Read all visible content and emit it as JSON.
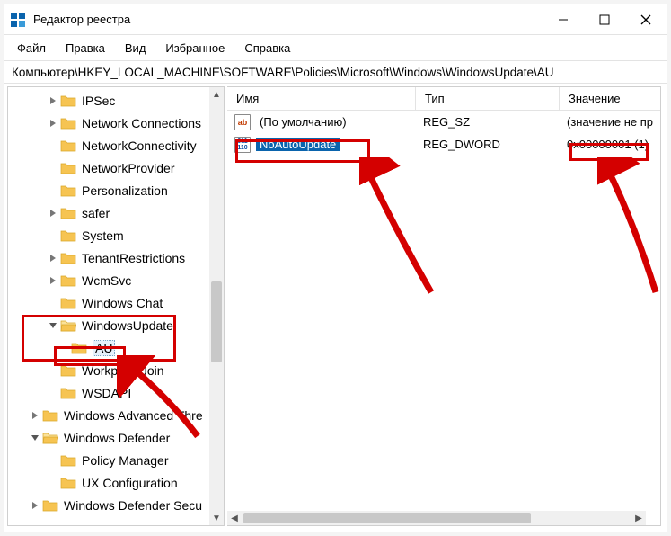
{
  "title": "Редактор реестра",
  "menu": [
    "Файл",
    "Правка",
    "Вид",
    "Избранное",
    "Справка"
  ],
  "address": "Компьютер\\HKEY_LOCAL_MACHINE\\SOFTWARE\\Policies\\Microsoft\\Windows\\WindowsUpdate\\AU",
  "tree": [
    {
      "label": "IPSec",
      "depth": 1,
      "exp": "r"
    },
    {
      "label": "Network Connections",
      "depth": 1,
      "exp": "r"
    },
    {
      "label": "NetworkConnectivity",
      "depth": 1,
      "exp": ""
    },
    {
      "label": "NetworkProvider",
      "depth": 1,
      "exp": ""
    },
    {
      "label": "Personalization",
      "depth": 1,
      "exp": ""
    },
    {
      "label": "safer",
      "depth": 1,
      "exp": "r"
    },
    {
      "label": "System",
      "depth": 1,
      "exp": ""
    },
    {
      "label": "TenantRestrictions",
      "depth": 1,
      "exp": "r"
    },
    {
      "label": "WcmSvc",
      "depth": 1,
      "exp": "r"
    },
    {
      "label": "Windows Chat",
      "depth": 1,
      "exp": ""
    },
    {
      "label": "WindowsUpdate",
      "depth": 1,
      "exp": "d",
      "open": true,
      "hl": true
    },
    {
      "label": "AU",
      "depth": 2,
      "exp": "",
      "hl": true,
      "selected": true
    },
    {
      "label": "WorkplaceJoin",
      "depth": 1,
      "exp": ""
    },
    {
      "label": "WSDAPI",
      "depth": 1,
      "exp": ""
    },
    {
      "label": "Windows Advanced Thre",
      "depth": 0,
      "exp": "r"
    },
    {
      "label": "Windows Defender",
      "depth": 0,
      "exp": "d",
      "open": true
    },
    {
      "label": "Policy Manager",
      "depth": 1,
      "exp": ""
    },
    {
      "label": "UX Configuration",
      "depth": 1,
      "exp": ""
    },
    {
      "label": "Windows Defender Secu",
      "depth": 0,
      "exp": "r"
    }
  ],
  "columns": {
    "name": "Имя",
    "type": "Тип",
    "value": "Значение"
  },
  "col_widths": {
    "name": 210,
    "type": 160,
    "value": 140
  },
  "rows": [
    {
      "icon": "ab",
      "name": "(По умолчанию)",
      "type": "REG_SZ",
      "value": "(значение не пр"
    },
    {
      "icon": "bin",
      "name": "NoAutoUpdate",
      "type": "REG_DWORD",
      "value": "0x00000001 (1)",
      "selected": true
    }
  ],
  "icons": {
    "ab": "ab",
    "bin": "011\n110"
  },
  "annotation_color": "#d40000"
}
